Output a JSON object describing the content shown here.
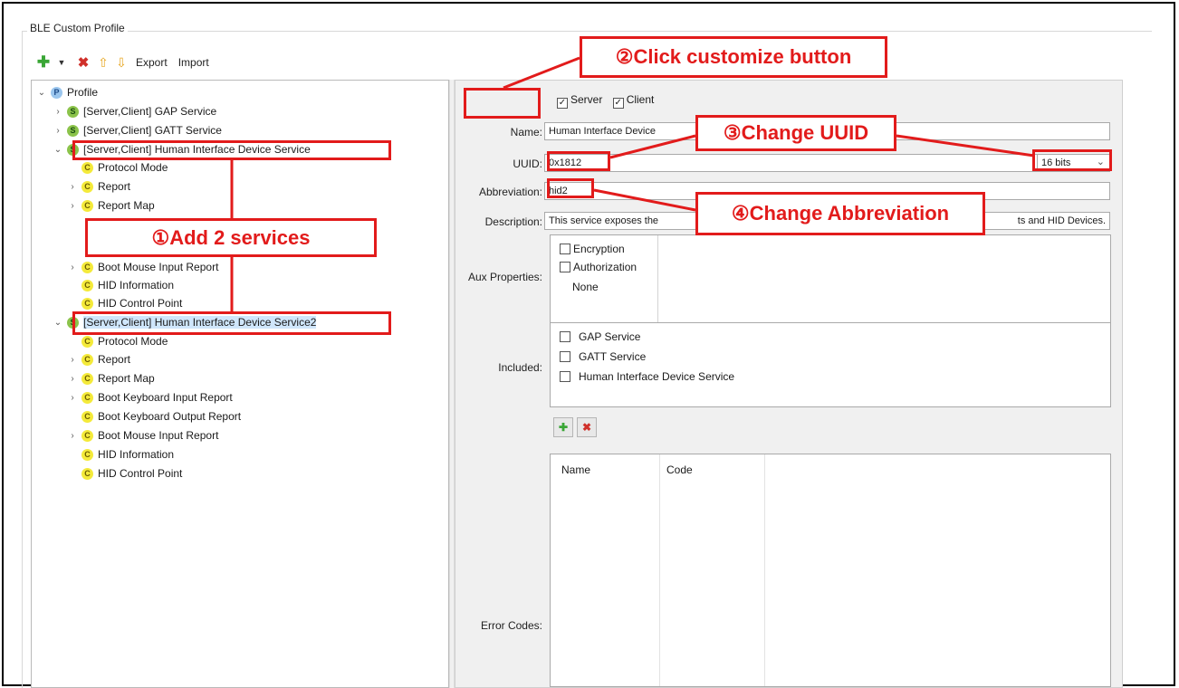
{
  "group_title": "BLE Custom Profile",
  "toolbar": {
    "add_icon": "plus-icon",
    "dropdown_icon": "chevron-down-icon",
    "delete_icon": "delete-icon",
    "up_icon": "arrow-up-icon",
    "down_icon": "arrow-down-icon",
    "export_label": "Export",
    "import_label": "Import"
  },
  "tree": {
    "profile": {
      "badge": "P",
      "label": "Profile"
    },
    "gap": {
      "badge": "S",
      "label": "[Server,Client] GAP Service"
    },
    "gatt": {
      "badge": "S",
      "label": "[Server,Client] GATT Service"
    },
    "hid1": {
      "badge": "S",
      "label": "[Server,Client] Human Interface Device Service",
      "children": [
        {
          "badge": "C",
          "label": "Protocol Mode"
        },
        {
          "badge": "C",
          "label": "Report"
        },
        {
          "badge": "C",
          "label": "Report Map"
        },
        {
          "badge": "C",
          "label": "Boot Mouse Input Report"
        },
        {
          "badge": "C",
          "label": "HID Information"
        },
        {
          "badge": "C",
          "label": "HID Control Point"
        }
      ]
    },
    "hid2": {
      "badge": "S",
      "label": "[Server,Client] Human Interface Device Service2",
      "children": [
        {
          "badge": "C",
          "label": "Protocol Mode"
        },
        {
          "badge": "C",
          "label": "Report"
        },
        {
          "badge": "C",
          "label": "Report Map"
        },
        {
          "badge": "C",
          "label": "Boot Keyboard Input Report"
        },
        {
          "badge": "C",
          "label": "Boot Keyboard Output Report"
        },
        {
          "badge": "C",
          "label": "Boot Mouse Input Report"
        },
        {
          "badge": "C",
          "label": "HID Information"
        },
        {
          "badge": "C",
          "label": "HID Control Point"
        }
      ]
    }
  },
  "form": {
    "server_label": "Server",
    "client_label": "Client",
    "server_checked": true,
    "client_checked": true,
    "name_label": "Name:",
    "name_value": "Human Interface Device",
    "uuid_label": "UUID:",
    "uuid_value": "0x1812",
    "uuid_size": "16 bits",
    "abbrev_label": "Abbreviation:",
    "abbrev_value": "hid2",
    "desc_label": "Description:",
    "desc_value_left": "This service exposes the",
    "desc_value_right": "ts and HID Devices.",
    "aux_label": "Aux Properties:",
    "aux_encryption": "Encryption",
    "aux_authorization": "Authorization",
    "aux_none": "None",
    "included_label": "Included:",
    "included_items": [
      "GAP Service",
      "GATT Service",
      "Human Interface Device Service"
    ],
    "errors_label": "Error Codes:",
    "errors_col_name": "Name",
    "errors_col_code": "Code"
  },
  "callouts": {
    "add_services": "①Add 2 services",
    "customize": "②Click customize button",
    "uuid": "③Change UUID",
    "abbreviation": "④Change Abbreviation"
  },
  "colors": {
    "annotation": "#e21b1b",
    "selection": "#cfe6fb",
    "panel_bg": "#f0f0f0"
  }
}
